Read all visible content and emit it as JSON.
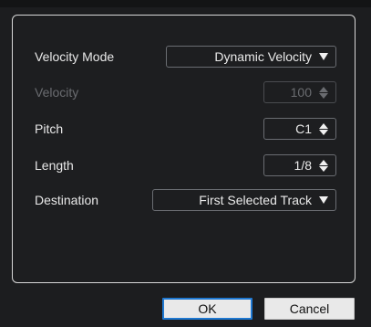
{
  "dialog": {
    "velocity_mode": {
      "label": "Velocity Mode",
      "value": "Dynamic Velocity"
    },
    "velocity": {
      "label": "Velocity",
      "value": "100"
    },
    "pitch": {
      "label": "Pitch",
      "value": "C1"
    },
    "length": {
      "label": "Length",
      "value": "1/8"
    },
    "destination": {
      "label": "Destination",
      "value": "First Selected Track"
    }
  },
  "buttons": {
    "ok_label": "OK",
    "cancel_label": "Cancel"
  },
  "colors": {
    "background": "#1d1e20",
    "focus_border": "#1f78d1",
    "button_face": "#e9e9e9"
  },
  "icons": {
    "dropdown": "chevron-down-icon",
    "spinner": "spinner-arrows-icon"
  }
}
